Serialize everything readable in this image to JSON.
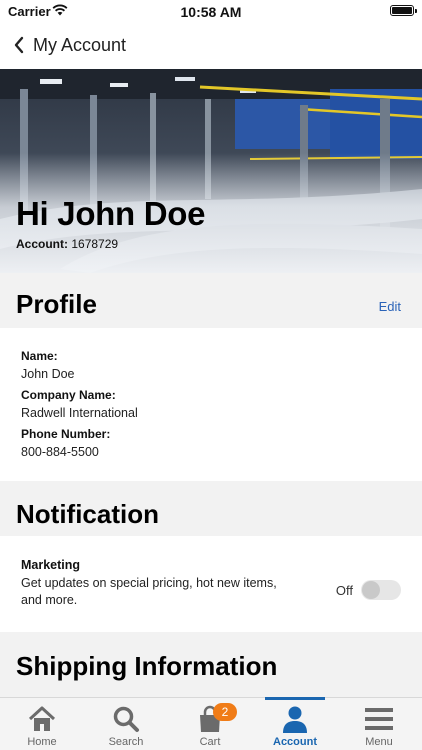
{
  "status_bar": {
    "carrier": "Carrier",
    "time": "10:58 AM"
  },
  "nav": {
    "title": "My Account",
    "back_icon": "chevron-left-icon"
  },
  "hero": {
    "greeting": "Hi John Doe",
    "account_label": "Account:",
    "account_number": "1678729"
  },
  "profile": {
    "title": "Profile",
    "edit_label": "Edit",
    "fields": [
      {
        "label": "Name:",
        "value": "John Doe"
      },
      {
        "label": "Company Name:",
        "value": "Radwell International"
      },
      {
        "label": "Phone Number:",
        "value": "800-884-5500"
      }
    ]
  },
  "notification": {
    "title": "Notification",
    "items": [
      {
        "label": "Marketing",
        "description": "Get updates on special pricing, hot new items, and more.",
        "state": "Off",
        "enabled": false
      }
    ]
  },
  "shipping": {
    "title": "Shipping Information"
  },
  "tab_bar": {
    "tabs": [
      {
        "label": "Home",
        "icon": "home-icon"
      },
      {
        "label": "Search",
        "icon": "search-icon"
      },
      {
        "label": "Cart",
        "icon": "cart-bag-icon",
        "badge": "2"
      },
      {
        "label": "Account",
        "icon": "account-icon",
        "active": true
      },
      {
        "label": "Menu",
        "icon": "hamburger-menu-icon"
      }
    ]
  },
  "colors": {
    "accent": "#1a66b0",
    "badge": "#f07c17",
    "link": "#2a63b8"
  }
}
